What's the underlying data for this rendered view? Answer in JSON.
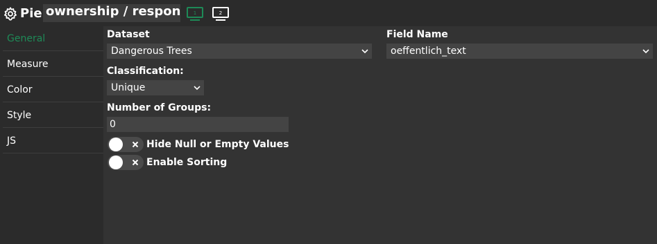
{
  "header": {
    "type_label": "Pie",
    "title_value": "ownership / responsib",
    "screen_1_label": "1",
    "screen_2_label": "2"
  },
  "colors": {
    "accent": "#1e8a57",
    "background": "#2b2b2b",
    "panel": "#333333",
    "field": "#444444"
  },
  "sidebar": {
    "items": [
      {
        "label": "General",
        "active": true
      },
      {
        "label": "Measure"
      },
      {
        "label": "Color"
      },
      {
        "label": "Style"
      },
      {
        "label": "JS"
      }
    ]
  },
  "form": {
    "dataset_label": "Dataset",
    "dataset_value": "Dangerous Trees",
    "field_name_label": "Field Name",
    "field_name_value": "oeffentlich_text",
    "classification_label": "Classification:",
    "classification_value": "Unique",
    "groups_label": "Number of Groups:",
    "groups_value": "0",
    "toggles": [
      {
        "label": "Hide Null or Empty Values",
        "enabled": false
      },
      {
        "label": "Enable Sorting",
        "enabled": false
      }
    ]
  },
  "icons": {
    "settings": "gear-icon",
    "screen_1": "monitor-icon",
    "screen_2": "monitor-icon",
    "dropdown": "chevron-down-icon",
    "toggle_off": "close-icon"
  }
}
